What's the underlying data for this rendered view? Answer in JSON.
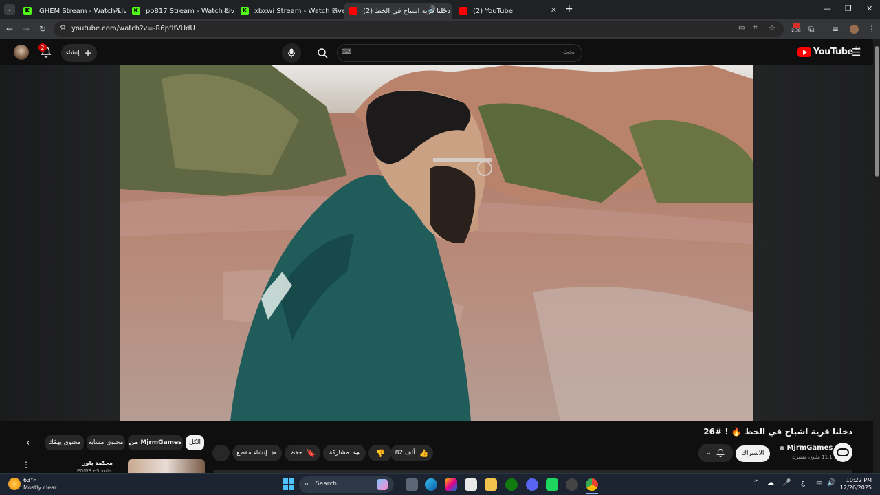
{
  "browser": {
    "tabs": [
      {
        "title": "IGHEM Stream - Watch Live on",
        "type": "kick",
        "active": false
      },
      {
        "title": "po817 Stream - Watch Live on K",
        "type": "kick",
        "active": false
      },
      {
        "title": "xbxwi Stream - Watch Live on K",
        "type": "kick",
        "active": false
      },
      {
        "title": "(2) دخلنا قرية اشباح في الخط",
        "type": "youtube",
        "active": true
      },
      {
        "title": "(2) YouTube",
        "type": "youtube",
        "active": false
      }
    ],
    "new_tab": "+",
    "url": "youtube.com/watch?v=-R6pfIfVUdU",
    "toolbar_badge": "2:38"
  },
  "youtube": {
    "notifications_count": "2",
    "create_label": "إنشاء",
    "search_placeholder": "بحث",
    "keyboard_icon": "⌨",
    "logo_text": "YouTube",
    "region": "SA"
  },
  "video": {
    "title": "دخلنا قرية اشباح في الخط 🔥 ! #26",
    "channel_name": "MjrmGames",
    "subscribers": "11.1 مليون مشترك",
    "subscribed_label": "الاشتراك",
    "likes_label": "82 ألف",
    "share_label": "مشاركة",
    "save_label": "حفظ",
    "clip_label": "إنشاء مقطع",
    "more_label": "..."
  },
  "chips": [
    {
      "label": "الكل",
      "selected": true
    },
    {
      "label": "من MjrmGames",
      "selected": false
    },
    {
      "label": "محتوى مشابه",
      "selected": false
    },
    {
      "label": "محتوى يهمّك",
      "selected": false
    }
  ],
  "recommended": {
    "title": "محكمة باور",
    "channel": "POWR eSports"
  },
  "taskbar": {
    "weather_temp": "63°F",
    "weather_desc": "Mostly clear",
    "search_label": "Search",
    "lang": "ع",
    "time": "10:22 PM",
    "date": "12/26/2025"
  }
}
